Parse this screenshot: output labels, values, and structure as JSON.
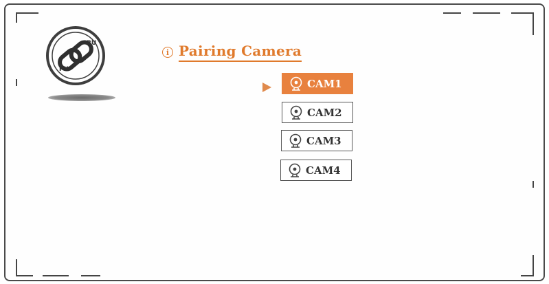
{
  "header": {
    "title": "Pairing Camera",
    "title_icon": "info-circle-icon",
    "title_icon_glyph": "i"
  },
  "logo": {
    "icon": "pairing-link-icon",
    "labels": [
      "BU",
      "PU"
    ]
  },
  "cameras": [
    {
      "label": "CAM1",
      "selected": true
    },
    {
      "label": "CAM2",
      "selected": false
    },
    {
      "label": "CAM3",
      "selected": false
    },
    {
      "label": "CAM4",
      "selected": false
    }
  ],
  "colors": {
    "accent": "#e8813e",
    "text": "#333333",
    "frame": "#4a4a4a"
  }
}
